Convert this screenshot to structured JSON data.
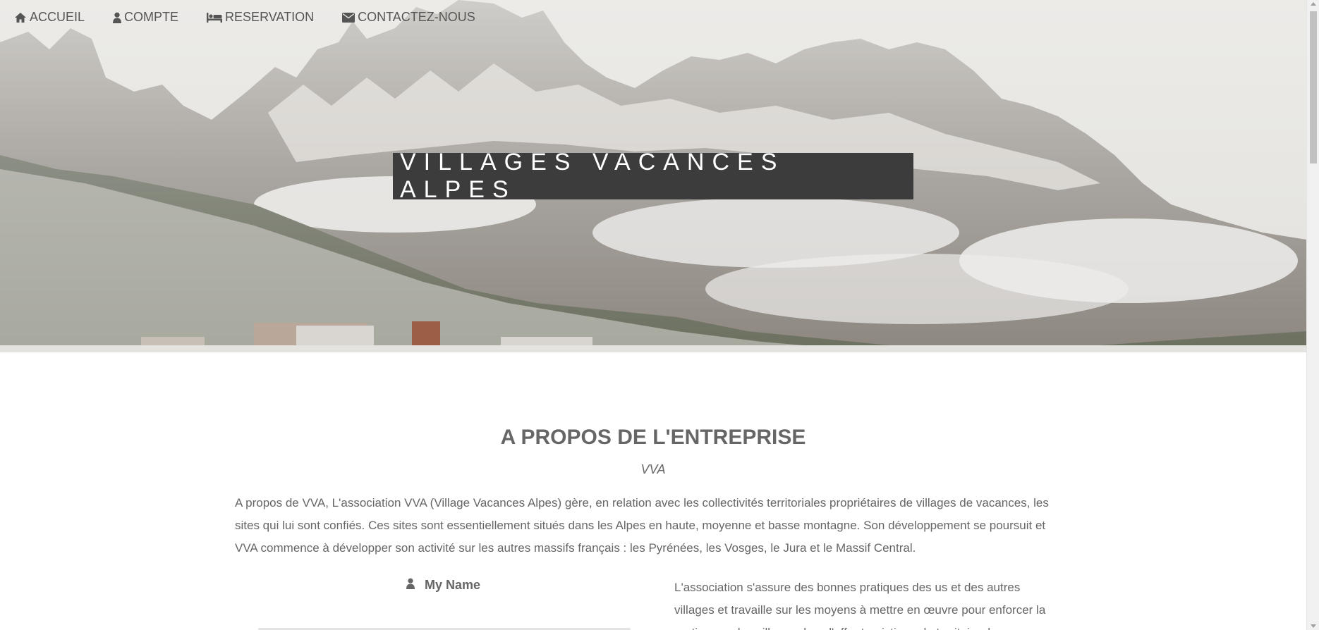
{
  "nav": {
    "items": [
      {
        "label": "ACCUEIL",
        "icon": "home-icon"
      },
      {
        "label": "COMPTE",
        "icon": "user-icon"
      },
      {
        "label": "RESERVATION",
        "icon": "bed-icon"
      },
      {
        "label": "CONTACTEZ-NOUS",
        "icon": "envelope-icon"
      }
    ]
  },
  "hero": {
    "title": "VILLAGES VACANCES ALPES",
    "image": "snowy-mountain-landscape"
  },
  "about": {
    "title": "A PROPOS DE L'ENTREPRISE",
    "subtitle": "VVA",
    "paragraph": "A propos de VVA, L'association VVA (Village Vacances Alpes) gère, en relation avec les collectivités territoriales propriétaires de villages de vacances, les sites qui lui sont confiés. Ces sites sont essentiellement situés dans les Alpes en haute, moyenne et basse montagne. Son développement se poursuit et VVA commence à développer son activité sur les autres massifs français : les Pyrénées, les Vosges, le Jura et le Massif Central."
  },
  "form": {
    "name_label": "My Name"
  },
  "side": {
    "paragraph": "L'association s'assure des bonnes pratiques des us et des autres villages et travaille sur les moyens à mettre en œuvre pour enforcer la pertinence des villages dans l'offre touristique du territoire de"
  },
  "colors": {
    "title_box_bg": "#3c3c3c",
    "text": "#666666",
    "nav_text": "#555555"
  }
}
